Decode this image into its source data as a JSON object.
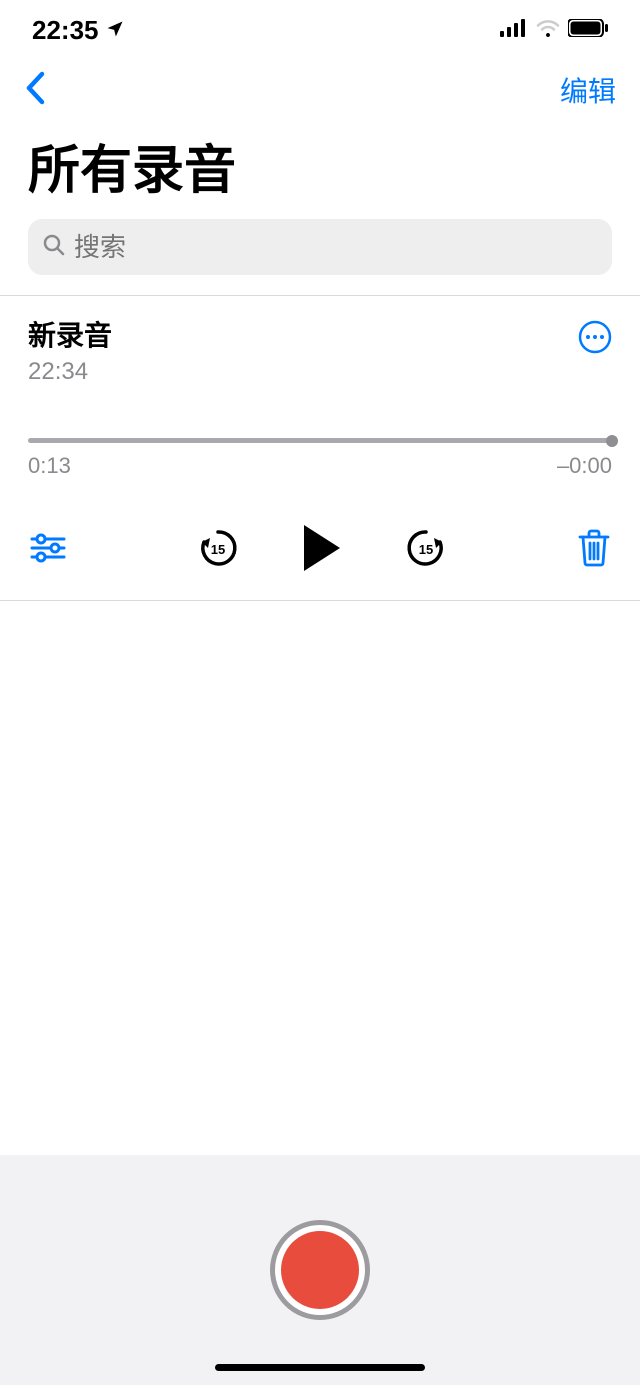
{
  "status": {
    "time": "22:35"
  },
  "nav": {
    "edit": "编辑"
  },
  "page_title": "所有录音",
  "search": {
    "placeholder": "搜索"
  },
  "recording": {
    "title": "新录音",
    "timestamp": "22:34",
    "elapsed": "0:13",
    "remaining": "–0:00",
    "skip_seconds": "15"
  }
}
